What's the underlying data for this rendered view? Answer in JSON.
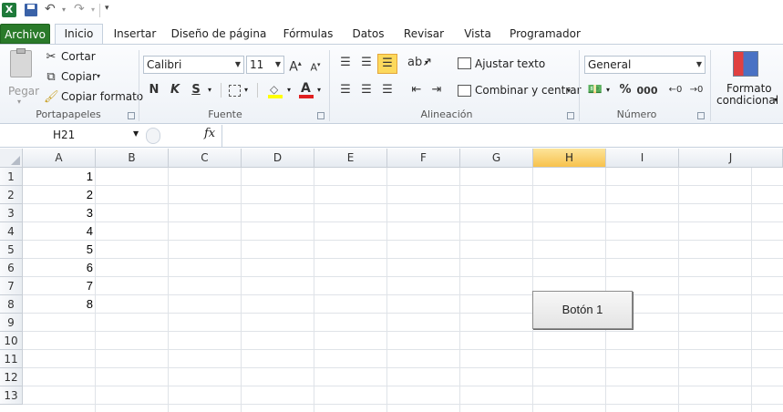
{
  "app": {
    "icon": "excel-logo-icon"
  },
  "qat": {
    "save_icon": "save-icon",
    "undo_icon": "undo-icon",
    "redo_icon": "redo-icon",
    "customize_icon": "customize-qat-icon"
  },
  "tabs": [
    {
      "label": "Archivo"
    },
    {
      "label": "Inicio"
    },
    {
      "label": "Insertar"
    },
    {
      "label": "Diseño de página"
    },
    {
      "label": "Fórmulas"
    },
    {
      "label": "Datos"
    },
    {
      "label": "Revisar"
    },
    {
      "label": "Vista"
    },
    {
      "label": "Programador"
    }
  ],
  "active_tab": "Inicio",
  "ribbon": {
    "clipboard": {
      "paste": "Pegar",
      "cut": "Cortar",
      "copy": "Copiar",
      "copy_format": "Copiar formato",
      "label": "Portapapeles"
    },
    "font": {
      "name": "Calibri",
      "size": "11",
      "bold": "N",
      "italic": "K",
      "underline": "S",
      "label": "Fuente"
    },
    "alignment": {
      "wrap": "Ajustar texto",
      "merge": "Combinar y centrar",
      "label": "Alineación"
    },
    "number": {
      "format": "General",
      "percent": "%",
      "thousands": "000",
      "label": "Número"
    },
    "styles": {
      "conditional_line1": "Formato",
      "conditional_line2": "condicional"
    }
  },
  "formula_bar": {
    "name_box": "H21",
    "fx": "fx",
    "value": ""
  },
  "columns": [
    "A",
    "B",
    "C",
    "D",
    "E",
    "F",
    "G",
    "H",
    "I",
    "J"
  ],
  "selected_column": "H",
  "rows": [
    "1",
    "2",
    "3",
    "4",
    "5",
    "6",
    "7",
    "8",
    "9",
    "10",
    "11",
    "12",
    "13"
  ],
  "cells_A": [
    "1",
    "2",
    "3",
    "4",
    "5",
    "6",
    "7",
    "8"
  ],
  "button": {
    "label": "Botón 1"
  }
}
